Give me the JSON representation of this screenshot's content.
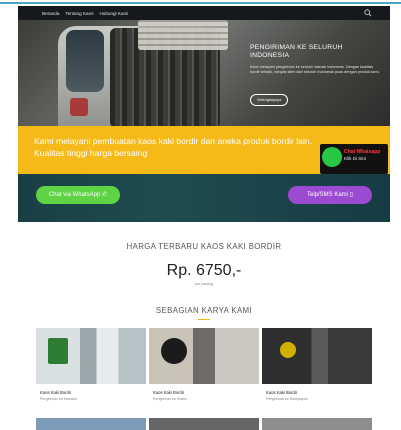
{
  "nav": {
    "items": [
      "Beranda",
      "Tentang Kami",
      "Hubungi Kami"
    ]
  },
  "hero": {
    "title": "PENGIRIMAN KE SELURUH INDONESIA",
    "text": "Kami melayani pengiriman ke seluruh daerah Indonesia. Dengan kualitas bordir terbaik, banyak klien dari seluruh Indonesia puas dengan produk kami.",
    "button_label": "Selengkapnya"
  },
  "banner": {
    "text": "Kami melayani pembuatan kaos kaki bordir dan aneka produk bordir lain. Kualitas tinggi harga bersaing",
    "badge_line1": "Chat Whatsapp",
    "badge_line2": "Klik Di Sini"
  },
  "cta": {
    "whatsapp_label": "Chat via WhatsApp",
    "sms_label": "Telp/SMS Kami"
  },
  "pricing": {
    "heading": "HARGA TERBARU KAOS KAKI BORDIR",
    "price": "Rp. 6750,-",
    "unit": "per pasang"
  },
  "gallery": {
    "heading": "SEBAGIAN KARYA KAMI",
    "cards": [
      {
        "title": "Kaos Kaki Bordir",
        "sub": "Pengiriman ke Manado"
      },
      {
        "title": "Kaos Kaki Bordir",
        "sub": "Pengiriman ke Klaten"
      },
      {
        "title": "Kaos Kaki Bordir",
        "sub": "Pengiriman ke Balikpapan"
      }
    ]
  },
  "colors": {
    "navbar": "#15181c",
    "banner_yellow": "#f5b918",
    "whatsapp_green": "#5ed343",
    "sms_purple": "#9b4bd1",
    "strip_teal": "#1e4c4f"
  }
}
